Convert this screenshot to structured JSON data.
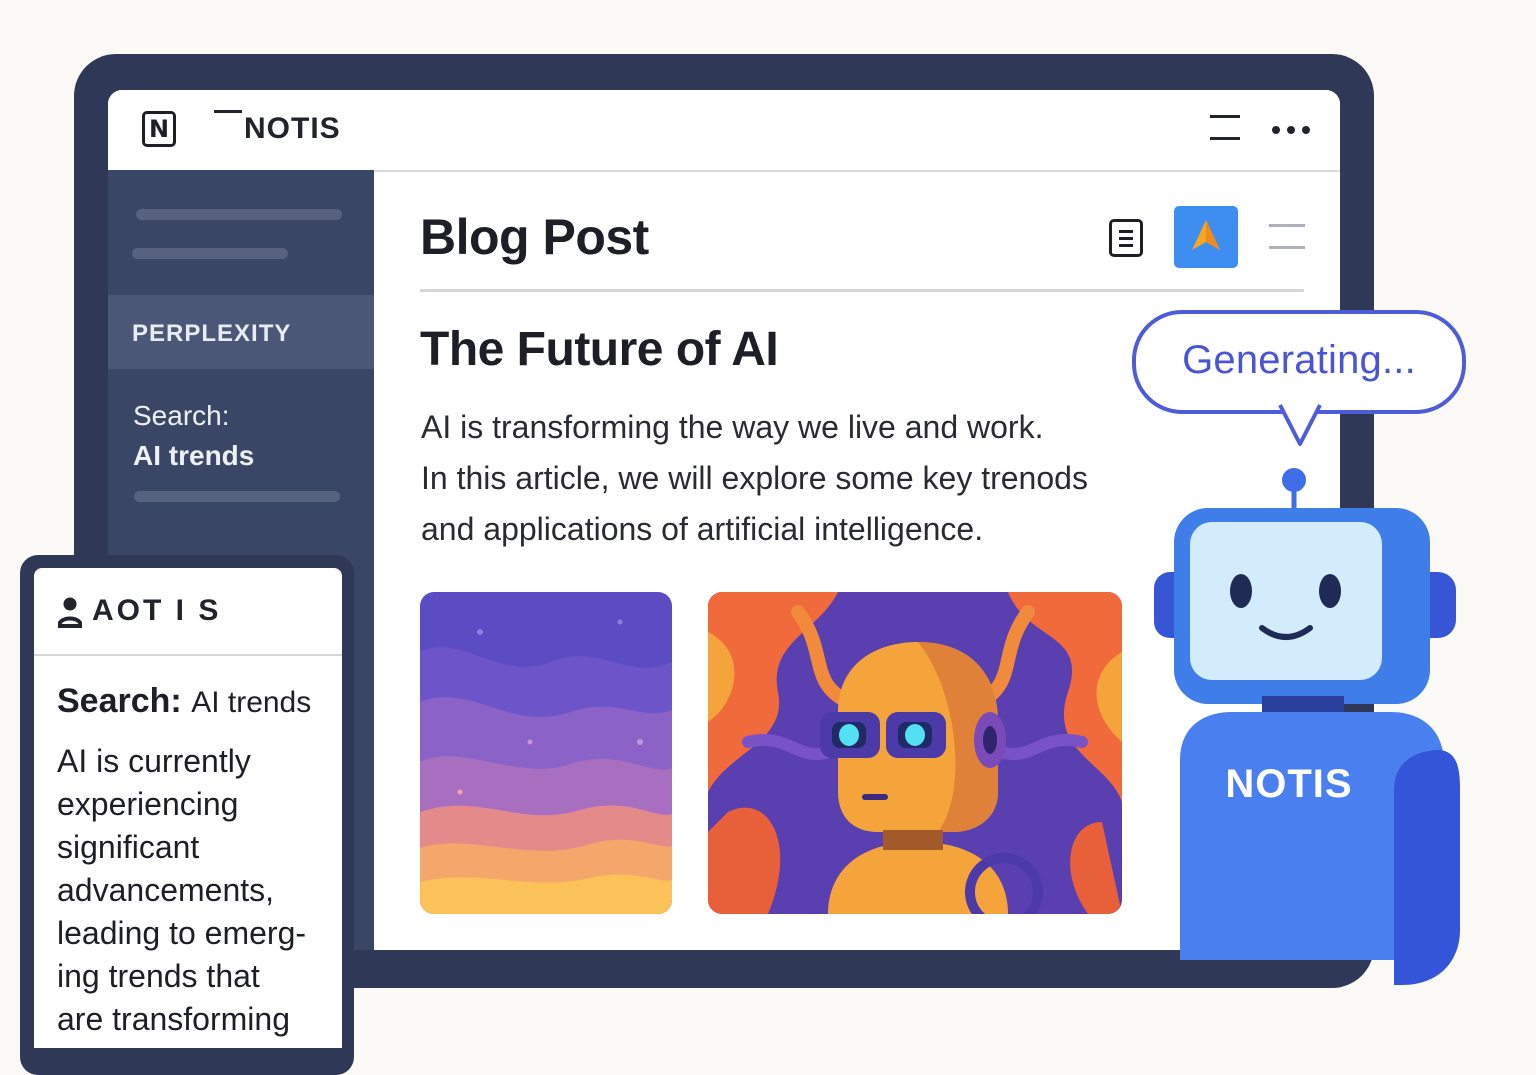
{
  "app": {
    "logo_letter": "N",
    "title": "NOTIS"
  },
  "sidebar": {
    "active_label": "PERPLEXITY",
    "search_label": "Search:",
    "search_query": "AI trends"
  },
  "main": {
    "page_title": "Blog Post",
    "article_title": "The Future of AI",
    "article_body_lines": [
      "AI is transforming the way we live and work.",
      "In this article, we will explore some key trenods",
      "and applications of artificial intelligence."
    ]
  },
  "panel": {
    "title": "AOT I S",
    "search_label": "Search:",
    "search_query": "AI trends",
    "body_lines": [
      "AI is currently",
      "experiencing",
      "significant",
      "advancements,",
      "leading to emerg-",
      "ing trends that",
      "are transforming"
    ]
  },
  "assistant": {
    "status": "Generating...",
    "mascot_label": "NOTIS"
  },
  "icons": {
    "app_logo": "notion-logo-icon",
    "menu": "hamburger-menu-icon",
    "more": "more-dots-icon",
    "document": "document-icon",
    "ai": "ai-arrow-icon",
    "list": "list-icon",
    "person": "person-icon"
  },
  "colors": {
    "frame": "#2f3957",
    "sidebar": "#3a4666",
    "accent_blue": "#3d8ef0",
    "bubble_purple": "#4f5cd8",
    "mascot_blue": "#3f6ee8"
  }
}
